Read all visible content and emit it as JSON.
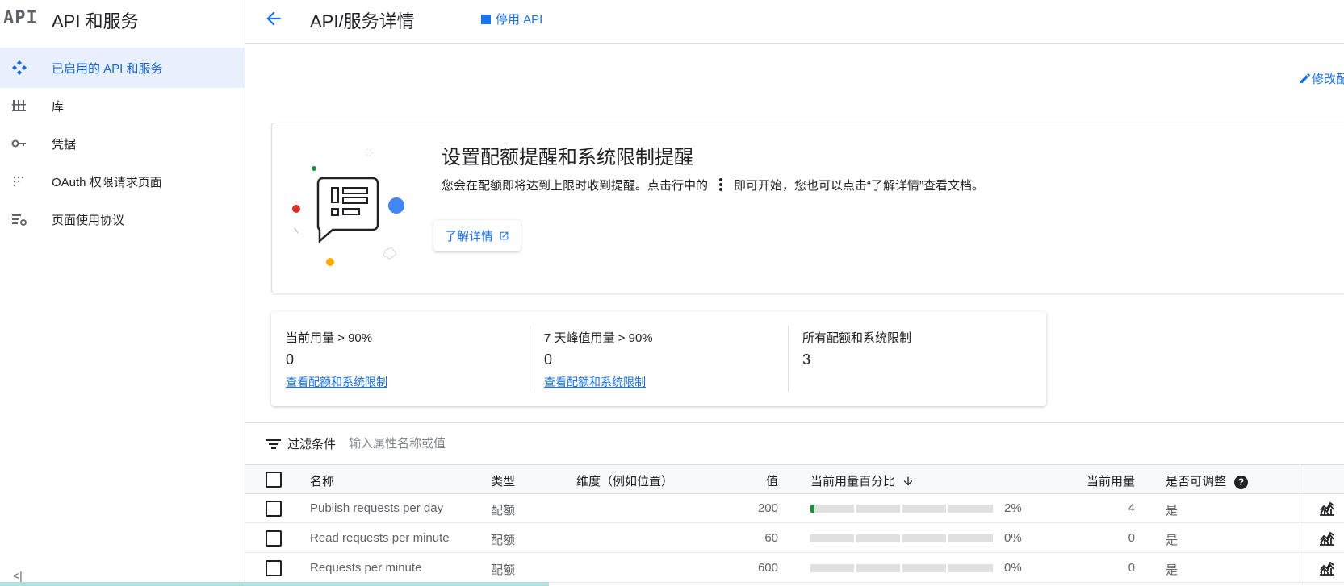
{
  "sidebar": {
    "logo": "API",
    "title": "API 和服务",
    "items": [
      {
        "label": "已启用的 API 和服务",
        "icon": "enabled-apis-icon"
      },
      {
        "label": "库",
        "icon": "library-icon"
      },
      {
        "label": "凭据",
        "icon": "key-icon"
      },
      {
        "label": "OAuth 权限请求页面",
        "icon": "oauth-consent-icon"
      },
      {
        "label": "页面使用协议",
        "icon": "page-agreement-icon"
      }
    ],
    "collapse_label": "<|"
  },
  "header": {
    "title": "API/服务详情",
    "disable_label": "停用 API",
    "edit_label": "修改配额"
  },
  "alert": {
    "title": "设置配额提醒和系统限制提醒",
    "desc_before": "您会在配额即将达到上限时收到提醒。点击行中的",
    "desc_after": "即可开始，您也可以点击“了解详情”查看文档。",
    "learn_more": "了解详情"
  },
  "summary": {
    "metrics": [
      {
        "label": "当前用量 > 90%",
        "value": "0",
        "link": "查看配额和系统限制"
      },
      {
        "label": "7 天峰值用量 > 90%",
        "value": "0",
        "link": "查看配额和系统限制"
      },
      {
        "label": "所有配额和系统限制",
        "value": "3"
      }
    ]
  },
  "filter": {
    "label": "过滤条件",
    "placeholder": "输入属性名称或值"
  },
  "table": {
    "headers": {
      "name": "名称",
      "type": "类型",
      "dimension": "维度（例如位置）",
      "value": "值",
      "usage_pct": "当前用量百分比",
      "current_usage": "当前用量",
      "adjustable": "是否可调整"
    },
    "rows": [
      {
        "name": "Publish requests per day",
        "type": "配额",
        "dimension": "",
        "value": "200",
        "pct": 2,
        "pct_text": "2%",
        "current": "4",
        "adjustable": "是"
      },
      {
        "name": "Read requests per minute",
        "type": "配额",
        "dimension": "",
        "value": "60",
        "pct": 0,
        "pct_text": "0%",
        "current": "0",
        "adjustable": "是"
      },
      {
        "name": "Requests per minute",
        "type": "配额",
        "dimension": "",
        "value": "600",
        "pct": 0,
        "pct_text": "0%",
        "current": "0",
        "adjustable": "是"
      }
    ]
  },
  "colors": {
    "accent": "#1a73e8",
    "active_bg": "#e8f0fe",
    "progress_fill": "#1e8e3e"
  }
}
